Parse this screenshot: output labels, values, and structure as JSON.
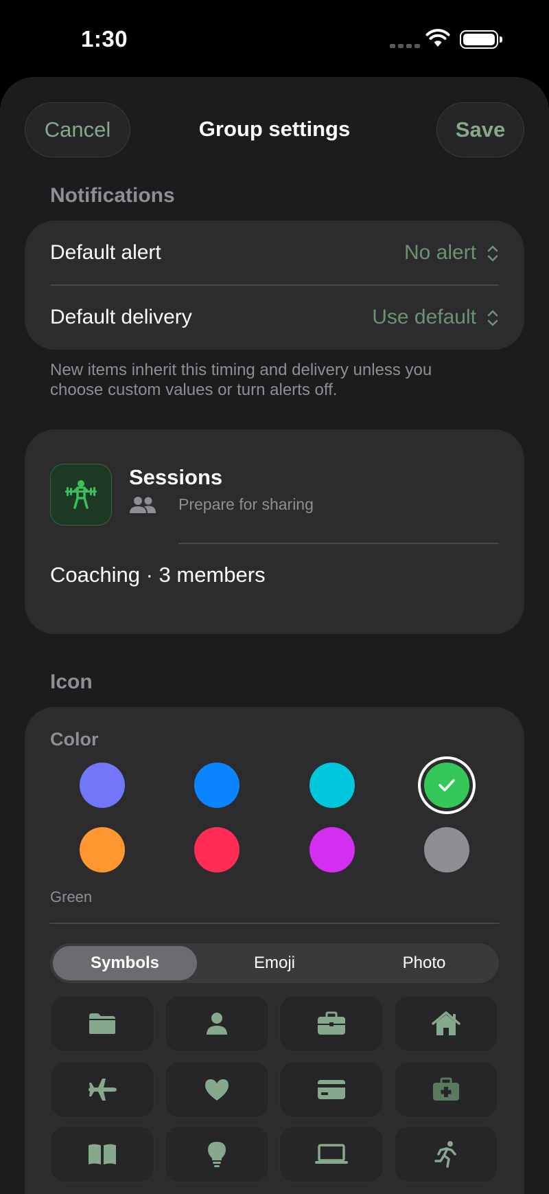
{
  "status": {
    "time": "1:30"
  },
  "header": {
    "cancel_label": "Cancel",
    "title": "Group settings",
    "save_label": "Save"
  },
  "notifications": {
    "section_title": "Notifications",
    "rows": [
      {
        "label": "Default alert",
        "value": "No alert"
      },
      {
        "label": "Default delivery",
        "value": "Use default"
      }
    ],
    "footnote": "New items inherit this timing and delivery unless you choose custom values or turn alerts off."
  },
  "group": {
    "name": "Sessions",
    "icon": "weightlifter-icon",
    "share_status": "Prepare for sharing",
    "members_line": "Coaching · 3 members"
  },
  "icon_section": {
    "section_title": "Icon",
    "color_label": "Color",
    "colors": [
      {
        "name": "indigo",
        "hex": "#7276f9"
      },
      {
        "name": "blue",
        "hex": "#0a84ff"
      },
      {
        "name": "cyan",
        "hex": "#00c8dc"
      },
      {
        "name": "green",
        "hex": "#34c759",
        "selected": true
      },
      {
        "name": "orange",
        "hex": "#ff9630"
      },
      {
        "name": "pink",
        "hex": "#ff2d55"
      },
      {
        "name": "purple",
        "hex": "#d42ef0"
      },
      {
        "name": "gray",
        "hex": "#8e8e93"
      }
    ],
    "selected_color_name": "Green",
    "tabs": [
      {
        "label": "Symbols",
        "active": true
      },
      {
        "label": "Emoji"
      },
      {
        "label": "Photo"
      }
    ],
    "symbols": [
      "folder-icon",
      "person-icon",
      "briefcase-icon",
      "house-icon",
      "airplane-icon",
      "heart-icon",
      "credit-card-icon",
      "medical-bag-icon",
      "book-icon",
      "lightbulb-icon",
      "laptop-icon",
      "running-figure-icon"
    ]
  },
  "accent_color": "#86a88c"
}
